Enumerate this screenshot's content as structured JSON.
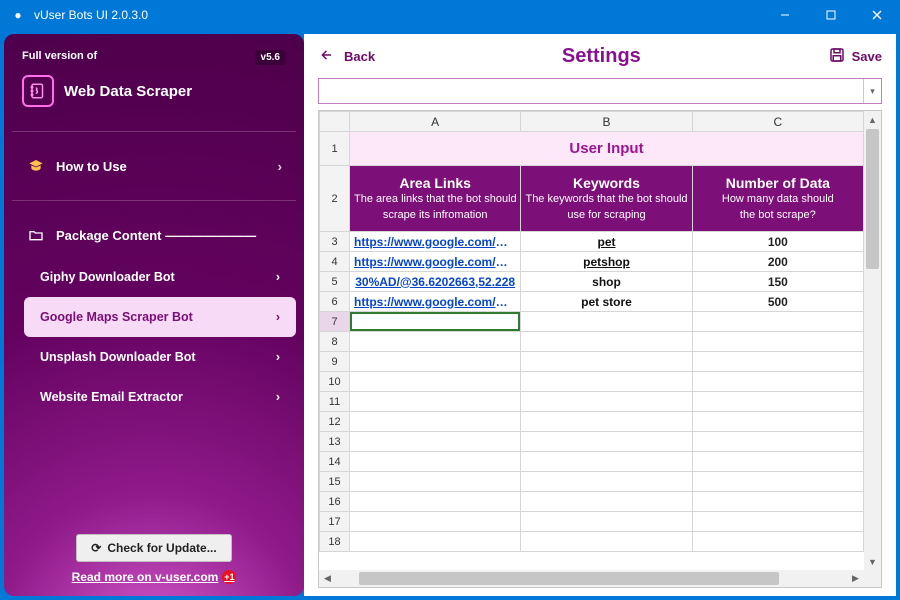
{
  "titlebar": {
    "title": "vUser Bots UI 2.0.3.0"
  },
  "sidebar": {
    "fullversion_label": "Full version of",
    "version_badge": "v5.6",
    "product_name": "Web Data Scraper",
    "howtouse": "How to Use",
    "pkgcontent": "Package Content ———————",
    "items": [
      {
        "label": "Giphy Downloader Bot"
      },
      {
        "label": "Google Maps Scraper Bot"
      },
      {
        "label": "Unsplash Downloader Bot"
      },
      {
        "label": "Website Email Extractor"
      }
    ],
    "check_update": "Check for Update...",
    "readmore": "Read more on v-user.com",
    "badge": "+1"
  },
  "main": {
    "back": "Back",
    "title": "Settings",
    "save": "Save",
    "columns": [
      "A",
      "B",
      "C"
    ],
    "user_input_title": "User Input",
    "headers": {
      "area": {
        "title": "Area Links",
        "sub1": "The area links that the bot should",
        "sub2": "scrape its infromation"
      },
      "keywords": {
        "title": "Keywords",
        "sub1": "The keywords that the bot should",
        "sub2": "use for scraping"
      },
      "num": {
        "title": "Number of Data",
        "sub1": "How many data should",
        "sub2": "the bot scrape?"
      }
    },
    "rows": [
      {
        "n": "3",
        "a": "https://www.google.com/map",
        "b": "pet",
        "c": "100",
        "link": true,
        "kw_underline": true
      },
      {
        "n": "4",
        "a": "https://www.google.com/map",
        "b": "petshop",
        "c": "200",
        "link": true,
        "kw_underline": true
      },
      {
        "n": "5",
        "a": "30%AD/@36.6202663,52.228",
        "b": "shop",
        "c": "150",
        "link": true,
        "kw_underline": false
      },
      {
        "n": "6",
        "a": "https://www.google.com/map",
        "b": "pet store",
        "c": "500",
        "link": true,
        "kw_underline": false
      }
    ],
    "empty_rows": [
      "7",
      "8",
      "9",
      "10",
      "11",
      "12",
      "13",
      "14",
      "15",
      "16",
      "17",
      "18"
    ]
  }
}
